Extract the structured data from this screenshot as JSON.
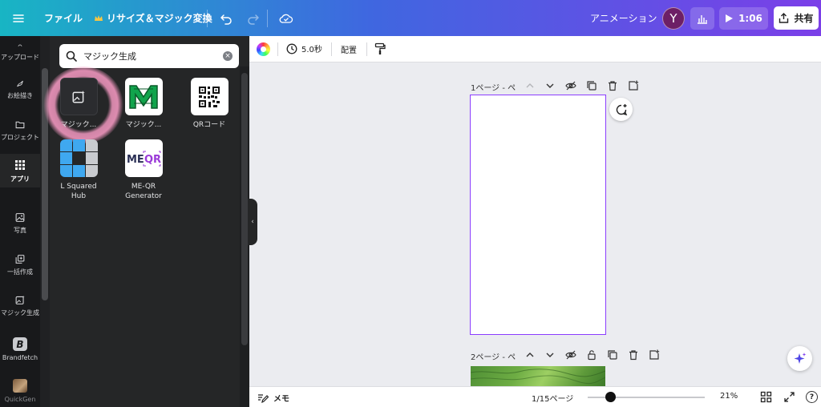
{
  "topbar": {
    "file_label": "ファイル",
    "resize_label": "リサイズ＆マジック変換",
    "animation_label": "アニメーション",
    "avatar_initial": "Y",
    "play_time": "1:06",
    "share_label": "共有"
  },
  "rail": {
    "items": [
      {
        "label": "アップロード",
        "icon": "upload-icon"
      },
      {
        "label": "お絵描き",
        "icon": "draw-icon"
      },
      {
        "label": "プロジェクト",
        "icon": "folder-icon"
      },
      {
        "label": "アプリ",
        "icon": "apps-grid-icon"
      },
      {
        "label": "写真",
        "icon": "photo-icon"
      },
      {
        "label": "一括作成",
        "icon": "bulk-create-icon"
      },
      {
        "label": "マジック生成",
        "icon": "magic-image-icon"
      },
      {
        "label": "Brandfetch",
        "icon": "brandfetch-logo"
      },
      {
        "label": "QuickGen",
        "icon": "quickgen-logo"
      }
    ]
  },
  "panel": {
    "search_value": "マジック生成",
    "apps": [
      {
        "label": "マジック..."
      },
      {
        "label": "マジック..."
      },
      {
        "label": "QRコード"
      },
      {
        "label": "L Squared Hub"
      },
      {
        "label": "ME-QR Generator"
      }
    ]
  },
  "toolbar": {
    "duration": "5.0秒",
    "position_label": "配置"
  },
  "canvas": {
    "page1_title": "1ページ - ペ",
    "page2_title": "2ページ - ペ"
  },
  "bottombar": {
    "memo_label": "メモ",
    "pages": "1/15ページ",
    "zoom": "21%",
    "zoom_level_fraction": 0.21,
    "help": "?"
  },
  "colors": {
    "accent": "#8b3dff",
    "panel_bg": "#252627",
    "rail_bg": "#18191b"
  }
}
